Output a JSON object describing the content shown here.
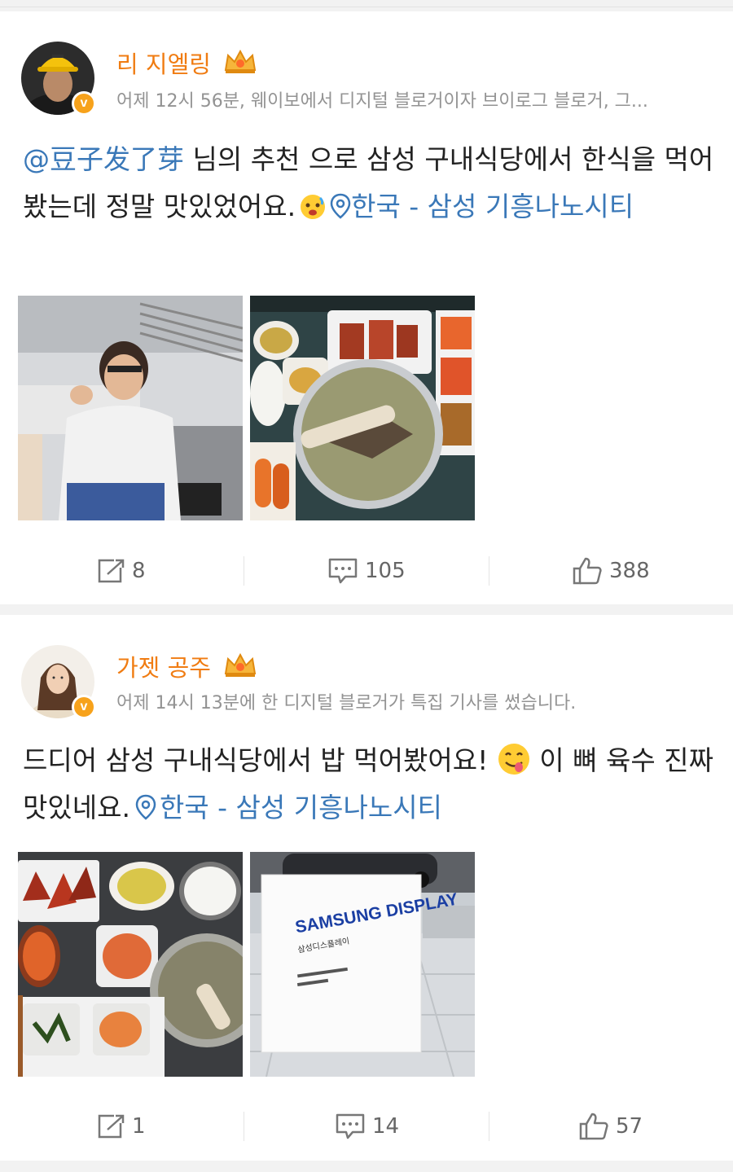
{
  "posts": [
    {
      "author": "리 지엘링",
      "meta": "어제 12시 56분, 웨이보에서 디지털 블로거이자 브이로그 블로거, 그...",
      "mention": "@豆子发了芽",
      "text_a": " 님의 추천 으로 삼성 구내식당에서 한식을 먹어봤는데 정말 맛있었어요.",
      "location": "한국 - 삼성 기흥나노시티",
      "reposts": "8",
      "comments": "105",
      "likes": "388"
    },
    {
      "author": "가젯 공주",
      "meta": "어제 14시 13분에 한 디지털 블로거가 특집 기사를 썼습니다.",
      "text_a": "드디어 삼성 구내식당에서 밥 먹어봤어요!",
      "text_b": " 이 뼈 육수 진짜 맛있네요.",
      "location": "한국 - 삼성 기흥나노시티",
      "sign_text": "SAMSUNG DISPLAY",
      "sign_sub": "삼성디스플레이",
      "reposts": "1",
      "comments": "14",
      "likes": "57"
    }
  ],
  "icons": {
    "verified": "v-badge-icon",
    "crown": "crown-icon",
    "emoji1": "hot-face-emoji",
    "emoji2": "yum-face-emoji",
    "location": "location-pin-icon",
    "repost": "repost-icon",
    "comment": "comment-icon",
    "like": "like-icon"
  },
  "colors": {
    "author": "#f07c12",
    "link": "#3a78b8",
    "meta": "#939393",
    "badge": "#f7a21b"
  },
  "verified_mark": "v"
}
